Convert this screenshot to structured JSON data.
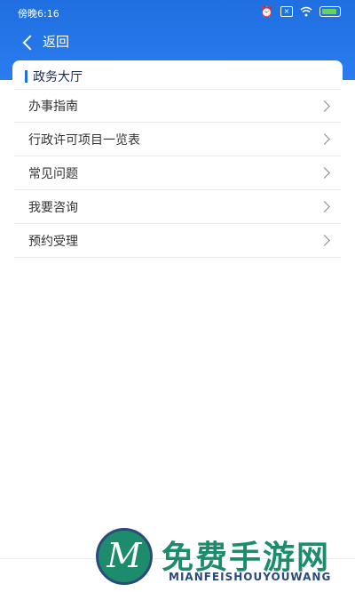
{
  "status_bar": {
    "time": "傍晚6:16",
    "icons": [
      "alarm-off-icon",
      "sim-icon",
      "wifi-icon",
      "battery-charging-icon"
    ]
  },
  "nav": {
    "back_label": "返回"
  },
  "section": {
    "title": "政务大厅"
  },
  "menu": {
    "items": [
      {
        "label": "办事指南"
      },
      {
        "label": "行政许可项目一览表"
      },
      {
        "label": "常见问题"
      },
      {
        "label": "我要咨询"
      },
      {
        "label": "预约受理"
      }
    ]
  },
  "watermark": {
    "logo_letter": "M",
    "title": "免费手游网",
    "subtitle": "MIANFEISHOUYOUWANG"
  },
  "colors": {
    "header_blue": "#1f6fe0",
    "accent_green": "#1c8c6c",
    "battery_green": "#6ad15a"
  }
}
